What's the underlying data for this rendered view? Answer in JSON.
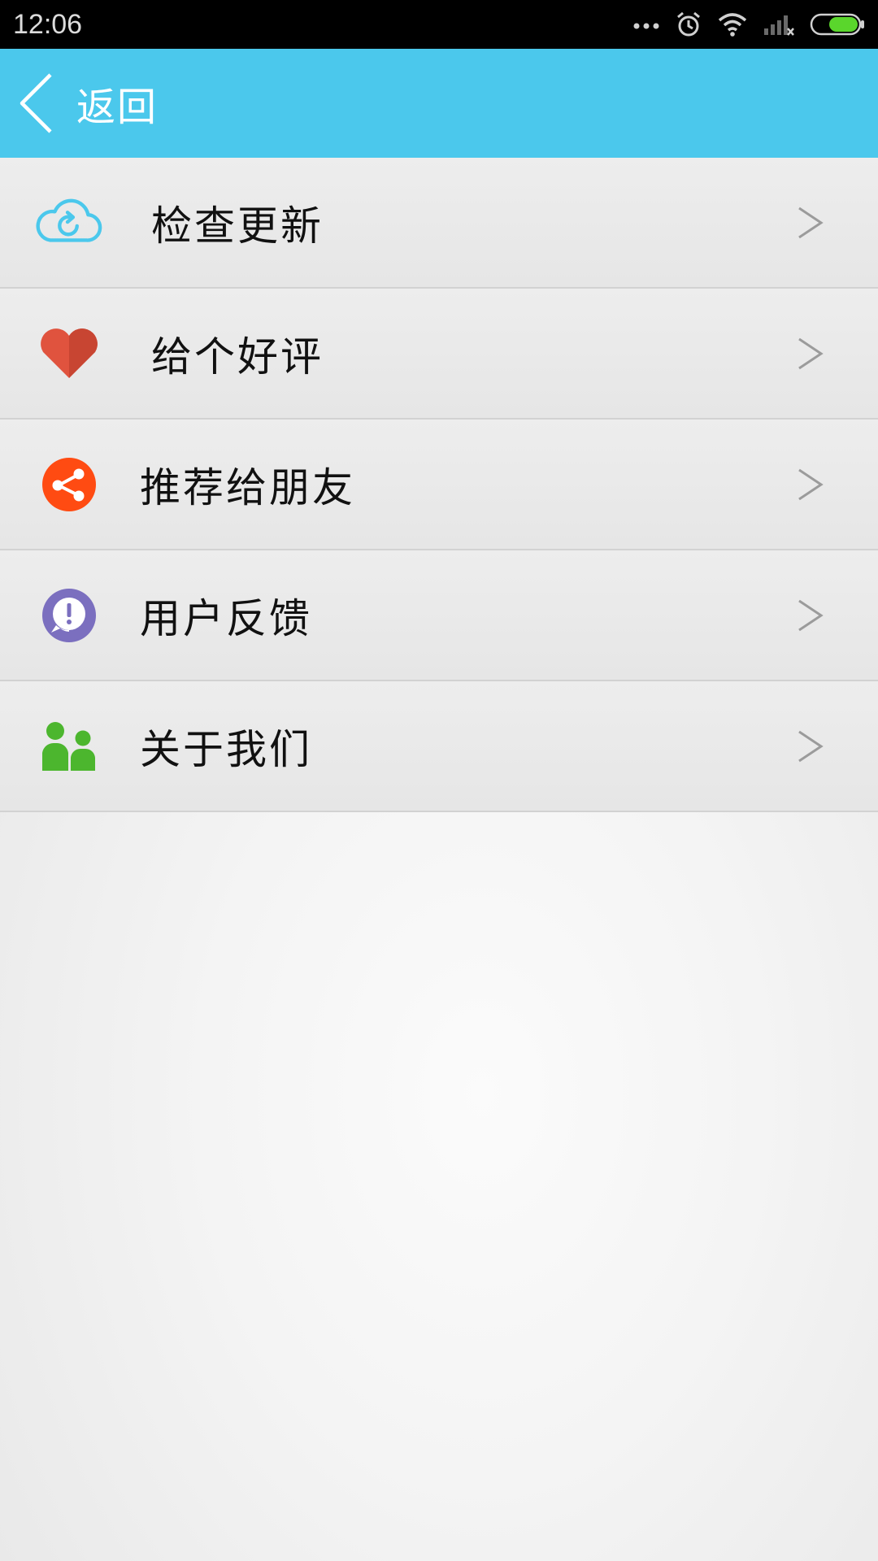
{
  "status_bar": {
    "time": "12:06",
    "icons": [
      "more-dots-icon",
      "alarm-icon",
      "wifi-icon",
      "signal-off-icon",
      "battery-icon"
    ]
  },
  "header": {
    "back_label": "返回",
    "background_color": "#4bc8ec"
  },
  "menu": {
    "items": [
      {
        "label": "检查更新",
        "icon": "cloud-refresh-icon",
        "icon_color": "#4bc8ec"
      },
      {
        "label": "给个好评",
        "icon": "heart-icon",
        "icon_color": "#e0533e"
      },
      {
        "label": "推荐给朋友",
        "icon": "share-icon",
        "icon_color": "#ff4b12"
      },
      {
        "label": "用户反馈",
        "icon": "feedback-icon",
        "icon_color": "#7b6fbf"
      },
      {
        "label": "关于我们",
        "icon": "users-icon",
        "icon_color": "#4cb62e"
      }
    ],
    "arrow_glyph": ">"
  }
}
